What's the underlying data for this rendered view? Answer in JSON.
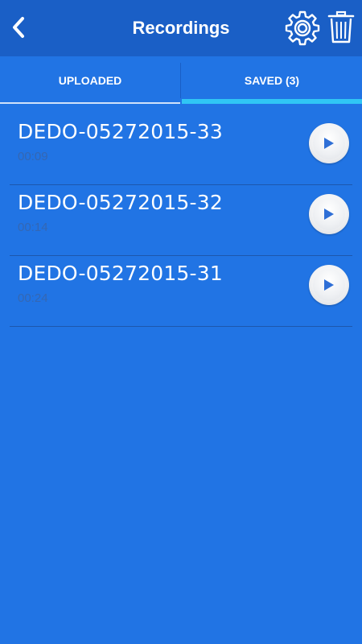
{
  "header": {
    "title": "Recordings",
    "back_icon": "chevron-left-icon",
    "settings_icon": "gear-icon",
    "delete_icon": "trash-icon"
  },
  "tabs": [
    {
      "label": "UPLOADED",
      "active": false
    },
    {
      "label": "SAVED (3)",
      "active": true
    }
  ],
  "recordings": [
    {
      "name": "DEDO-05272015-33",
      "duration": "00:09"
    },
    {
      "name": "DEDO-05272015-32",
      "duration": "00:14"
    },
    {
      "name": "DEDO-05272015-31",
      "duration": "00:24"
    }
  ],
  "colors": {
    "background": "#2174e4",
    "header": "#1a5fc6",
    "active_tab_indicator": "#30c6f5",
    "duration_text": "#3467b3",
    "play_icon": "#2f6fd6"
  }
}
